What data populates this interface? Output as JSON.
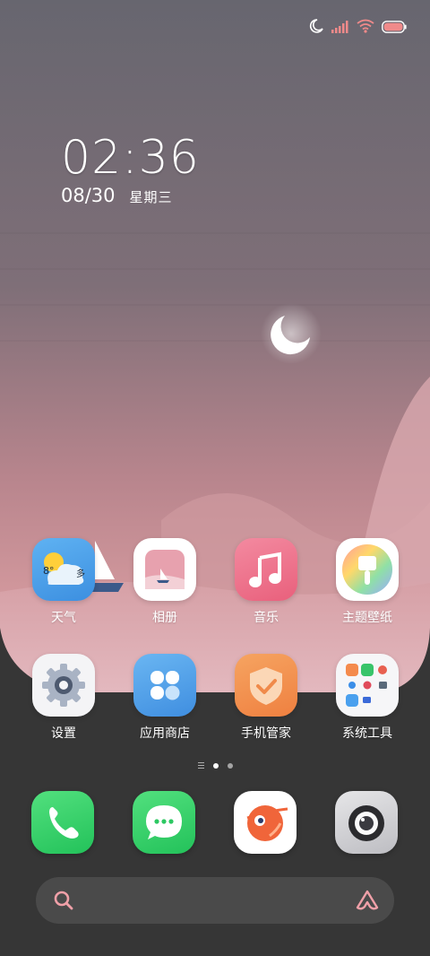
{
  "status_bar": {
    "icons": [
      "moon-icon",
      "signal-icon",
      "wifi-icon",
      "battery-icon"
    ],
    "accent_color": "#f08a8a"
  },
  "clock": {
    "time": "02:36",
    "date": "08/30",
    "weekday": "星期三"
  },
  "weather_widget": {
    "temperature": "8°",
    "condition": "多"
  },
  "apps_row1": [
    {
      "label": "天气",
      "icon": "weather-icon"
    },
    {
      "label": "相册",
      "icon": "gallery-icon"
    },
    {
      "label": "音乐",
      "icon": "music-icon"
    },
    {
      "label": "主题壁纸",
      "icon": "themes-icon"
    }
  ],
  "apps_row2": [
    {
      "label": "设置",
      "icon": "settings-gear-icon"
    },
    {
      "label": "应用商店",
      "icon": "app-store-icon"
    },
    {
      "label": "手机管家",
      "icon": "security-shield-icon"
    },
    {
      "label": "系统工具",
      "icon": "tools-folder-icon"
    }
  ],
  "dock": [
    {
      "icon": "phone-icon"
    },
    {
      "icon": "messages-icon"
    },
    {
      "icon": "browser-planet-icon"
    },
    {
      "icon": "camera-icon"
    }
  ],
  "page_indicator": {
    "current": 1,
    "total": 2
  },
  "search_bar": {
    "left_icon": "search-icon",
    "right_icon": "assistant-icon"
  },
  "colors": {
    "sky_top": "#6b6874",
    "sky_mid": "#c98c93",
    "ground": "#3a3a3a"
  }
}
